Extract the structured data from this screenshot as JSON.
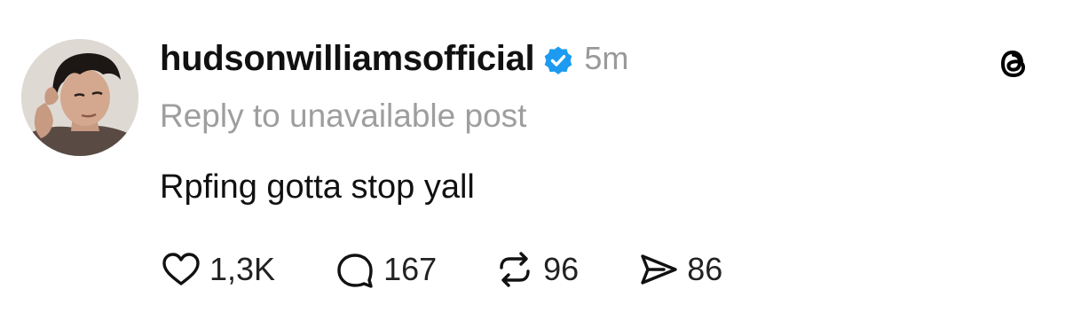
{
  "post": {
    "username": "hudsonwilliamsofficial",
    "verified": true,
    "time_ago": "5m",
    "reply_context": "Reply to unavailable post",
    "text": "Rpfing gotta stop yall",
    "stats": {
      "likes": "1,3K",
      "replies": "167",
      "reposts": "96",
      "shares": "86"
    }
  },
  "icons": {
    "verified": "verified-badge-icon",
    "app_logo": "threads-logo-icon",
    "like": "heart-icon",
    "reply": "comment-bubble-icon",
    "repost": "repost-icon",
    "share": "send-icon"
  },
  "colors": {
    "verified_blue": "#1d9bf0",
    "muted_text": "#999999",
    "primary_text": "#111111"
  }
}
